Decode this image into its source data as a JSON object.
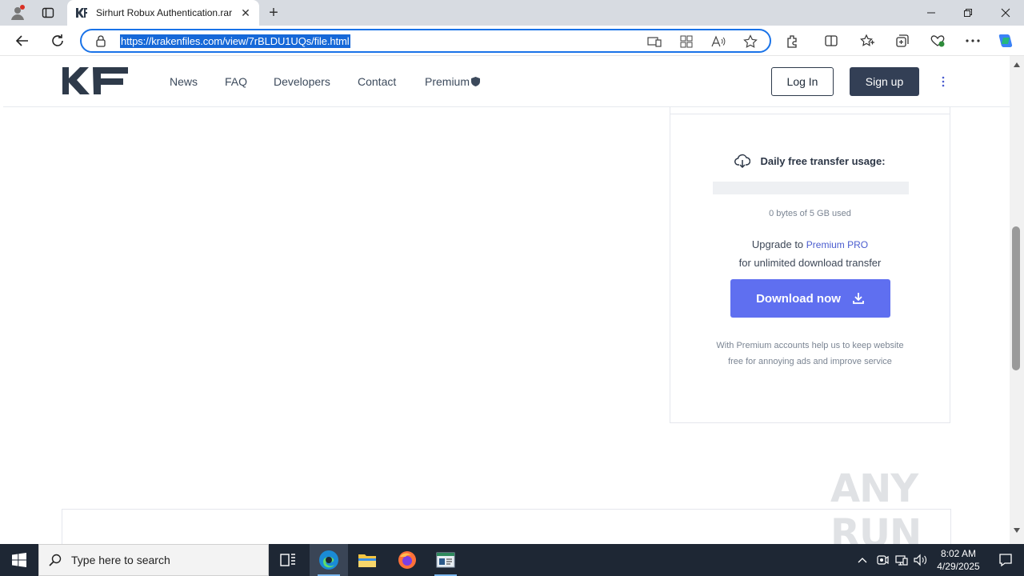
{
  "browser": {
    "tab_title": "Sirhurt Robux Authentication.rar",
    "url": "https://krakenfiles.com/view/7rBLDU1UQs/file.html"
  },
  "site": {
    "logo_text": "KF",
    "nav": [
      "News",
      "FAQ",
      "Developers",
      "Contact",
      "Premium"
    ],
    "login_label": "Log In",
    "signup_label": "Sign up"
  },
  "card": {
    "usage_title": "Daily free transfer usage:",
    "usage_fraction": 0,
    "usage_text": "0 bytes of 5 GB used",
    "upgrade_prefix": "Upgrade to",
    "upgrade_link": "Premium PRO",
    "upgrade_line2": "for unlimited download transfer",
    "download_label": "Download now",
    "note": "With Premium accounts help us to keep website free for annoying ads and improve service"
  },
  "watermark": "ANY RUN",
  "taskbar": {
    "search_placeholder": "Type here to search",
    "time": "8:02 AM",
    "date": "4/29/2025"
  },
  "colors": {
    "accent_blue": "#5f6ff0",
    "header_dark": "#333f55",
    "omnibox_focus": "#1a73e8",
    "taskbar": "#1e2734"
  }
}
